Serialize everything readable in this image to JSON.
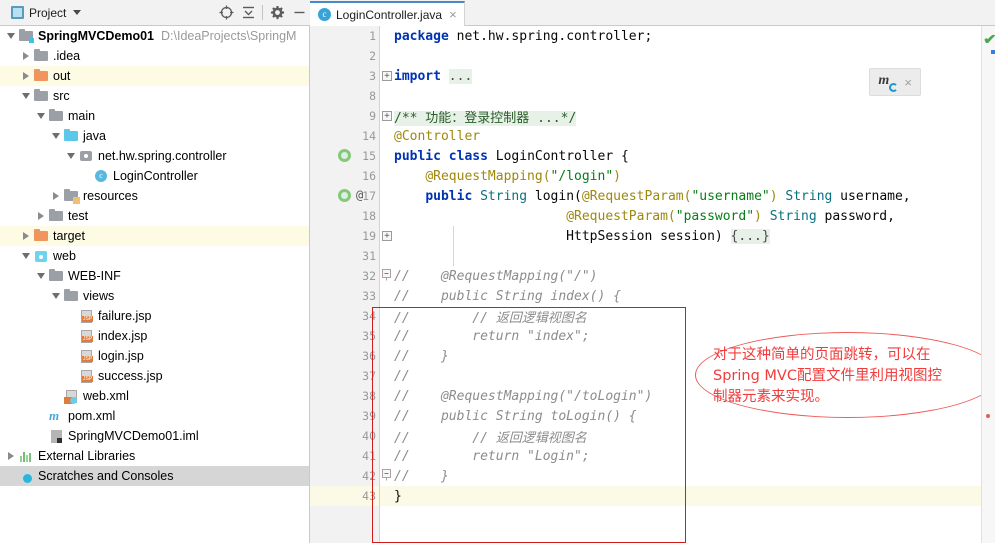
{
  "project_panel": {
    "title": "Project",
    "title_icon": "project-window-icon",
    "toolbar": [
      {
        "name": "locate-icon",
        "glyph": "crosshair"
      },
      {
        "name": "collapse-all-icon",
        "glyph": "collapse"
      },
      {
        "name": "settings-gear-icon",
        "glyph": "gear"
      },
      {
        "name": "hide-panel-icon",
        "glyph": "minus"
      }
    ],
    "tree": [
      {
        "label": "SpringMVCDemo01",
        "path": "D:\\IdeaProjects\\SpringM",
        "indent": 0,
        "twisty": "down",
        "icon": "module-folder-icon",
        "bold": true,
        "highlight": "none"
      },
      {
        "label": ".idea",
        "path": "",
        "indent": 1,
        "twisty": "right",
        "icon": "folder-icon",
        "bold": false,
        "highlight": "none"
      },
      {
        "label": "out",
        "path": "",
        "indent": 1,
        "twisty": "right",
        "icon": "excluded-folder-icon",
        "bold": false,
        "highlight": "yellow"
      },
      {
        "label": "src",
        "path": "",
        "indent": 1,
        "twisty": "down",
        "icon": "folder-icon",
        "bold": false,
        "highlight": "none"
      },
      {
        "label": "main",
        "path": "",
        "indent": 2,
        "twisty": "down",
        "icon": "folder-icon",
        "bold": false,
        "highlight": "none"
      },
      {
        "label": "java",
        "path": "",
        "indent": 3,
        "twisty": "down",
        "icon": "source-root-icon",
        "bold": false,
        "highlight": "none"
      },
      {
        "label": "net.hw.spring.controller",
        "path": "",
        "indent": 4,
        "twisty": "down",
        "icon": "package-icon",
        "bold": false,
        "highlight": "none"
      },
      {
        "label": "LoginController",
        "path": "",
        "indent": 5,
        "twisty": "none",
        "icon": "java-class-icon",
        "bold": false,
        "highlight": "none"
      },
      {
        "label": "resources",
        "path": "",
        "indent": 3,
        "twisty": "right",
        "icon": "resources-root-icon",
        "bold": false,
        "highlight": "none"
      },
      {
        "label": "test",
        "path": "",
        "indent": 2,
        "twisty": "right",
        "icon": "folder-icon",
        "bold": false,
        "highlight": "none"
      },
      {
        "label": "target",
        "path": "",
        "indent": 1,
        "twisty": "right",
        "icon": "excluded-folder-icon",
        "bold": false,
        "highlight": "yellow"
      },
      {
        "label": "web",
        "path": "",
        "indent": 1,
        "twisty": "down",
        "icon": "web-module-icon",
        "bold": false,
        "highlight": "none"
      },
      {
        "label": "WEB-INF",
        "path": "",
        "indent": 2,
        "twisty": "down",
        "icon": "folder-icon",
        "bold": false,
        "highlight": "none"
      },
      {
        "label": "views",
        "path": "",
        "indent": 3,
        "twisty": "down",
        "icon": "folder-icon",
        "bold": false,
        "highlight": "none"
      },
      {
        "label": "failure.jsp",
        "path": "",
        "indent": 4,
        "twisty": "none",
        "icon": "jsp-file-icon",
        "bold": false,
        "highlight": "none"
      },
      {
        "label": "index.jsp",
        "path": "",
        "indent": 4,
        "twisty": "none",
        "icon": "jsp-file-icon",
        "bold": false,
        "highlight": "none"
      },
      {
        "label": "login.jsp",
        "path": "",
        "indent": 4,
        "twisty": "none",
        "icon": "jsp-file-icon",
        "bold": false,
        "highlight": "none"
      },
      {
        "label": "success.jsp",
        "path": "",
        "indent": 4,
        "twisty": "none",
        "icon": "jsp-file-icon",
        "bold": false,
        "highlight": "none"
      },
      {
        "label": "web.xml",
        "path": "",
        "indent": 3,
        "twisty": "none",
        "icon": "xml-file-icon",
        "bold": false,
        "highlight": "none"
      },
      {
        "label": "pom.xml",
        "path": "",
        "indent": 2,
        "twisty": "none",
        "icon": "maven-pom-icon",
        "bold": false,
        "highlight": "none"
      },
      {
        "label": "SpringMVCDemo01.iml",
        "path": "",
        "indent": 2,
        "twisty": "none",
        "icon": "iml-file-icon",
        "bold": false,
        "highlight": "none"
      },
      {
        "label": "External Libraries",
        "path": "",
        "indent": 0,
        "twisty": "right",
        "icon": "external-libraries-icon",
        "bold": false,
        "highlight": "none"
      },
      {
        "label": "Scratches and Consoles",
        "path": "",
        "indent": 0,
        "twisty": "none",
        "icon": "scratches-icon",
        "bold": false,
        "highlight": "gray"
      }
    ]
  },
  "editor": {
    "tab": {
      "label": "LoginController.java",
      "icon_letter": "c",
      "close_glyph": "×"
    },
    "gutter_numbers": [
      "1",
      "2",
      "3",
      "8",
      "9",
      "14",
      "15",
      "16",
      "17",
      "18",
      "19",
      "31",
      "32",
      "33",
      "34",
      "35",
      "36",
      "37",
      "38",
      "39",
      "40",
      "41",
      "42",
      "43"
    ],
    "gutter_marks": {
      "15": "overridden-method-icon",
      "17": "overridden-method-icon"
    },
    "gutter_at_marker": {
      "17": "@"
    },
    "current_line": "43",
    "lines": [
      {
        "n": "1",
        "html": "<span class='kw'>package</span> net.hw.spring.controller;"
      },
      {
        "n": "2",
        "html": ""
      },
      {
        "n": "3",
        "html": "<span class='kw'>import</span> <span class='fld'>...</span>",
        "fold": "plus"
      },
      {
        "n": "8",
        "html": ""
      },
      {
        "n": "9",
        "html": "<span class='docc'>/** 功能：登录控制器 ...*/</span>",
        "fold": "plus"
      },
      {
        "n": "14",
        "html": "<span class='anno'>@Controller</span>"
      },
      {
        "n": "15",
        "html": "<span class='kw'>public</span> <span class='kw'>class</span> LoginController {"
      },
      {
        "n": "16",
        "html": "    <span class='anno'>@RequestMapping(</span><span class='str'>\"/login\"</span><span class='anno'>)</span>"
      },
      {
        "n": "17",
        "html": "    <span class='kw'>public</span> <span class='typ'>String</span> login(<span class='anno'>@RequestParam(</span><span class='str'>\"username\"</span><span class='anno'>)</span> <span class='typ'>String</span> username,"
      },
      {
        "n": "18",
        "html": "                      <span class='anno'>@RequestParam(</span><span class='str'>\"password\"</span><span class='anno'>)</span> <span class='typ'>String</span> password,"
      },
      {
        "n": "19",
        "html": "                      HttpSession session) <span class='fld'>{...}</span>",
        "fold": "plus"
      },
      {
        "n": "31",
        "html": ""
      },
      {
        "n": "32",
        "html": "<span class='cmt'>//    @RequestMapping(\"/\")</span>",
        "fold": "minus"
      },
      {
        "n": "33",
        "html": "<span class='cmt'>//    public String index() {</span>"
      },
      {
        "n": "34",
        "html": "<span class='cmt'>//        // 返回逻辑视图名</span>"
      },
      {
        "n": "35",
        "html": "<span class='cmt'>//        return \"index\";</span>"
      },
      {
        "n": "36",
        "html": "<span class='cmt'>//    }</span>"
      },
      {
        "n": "37",
        "html": "<span class='cmt'>//</span>"
      },
      {
        "n": "38",
        "html": "<span class='cmt'>//    @RequestMapping(\"/toLogin\")</span>"
      },
      {
        "n": "39",
        "html": "<span class='cmt'>//    public String toLogin() {</span>"
      },
      {
        "n": "40",
        "html": "<span class='cmt'>//        // 返回逻辑视图名</span>"
      },
      {
        "n": "41",
        "html": "<span class='cmt'>//        return \"Login\";</span>"
      },
      {
        "n": "42",
        "html": "<span class='cmt'>//    }</span>",
        "fold": "minus"
      },
      {
        "n": "43",
        "html": "}",
        "current": true
      }
    ]
  },
  "annotations": {
    "red_rect_label": "commented-code-highlight",
    "red_note_text": "对于这种简单的页面跳转，可以在\nSpring MVC配置文件里利用视图控\n制器元素来实现。",
    "colors": {
      "rect": "#d21b1b",
      "ellipse": "#ee5a5a",
      "text": "#f23b3b"
    }
  },
  "maven_notification": {
    "icon": "maven-reload-icon",
    "close_glyph": "×"
  },
  "inspection": {
    "status_glyph": "✔",
    "status_color": "#49a84c"
  },
  "colors": {
    "excluded_row": "#fdfbe3",
    "selected_row": "#d6d6d6",
    "tab_active_top": "#4a88c7",
    "keyword": "#0033b3",
    "annotation": "#9e880d",
    "string": "#067d17",
    "comment": "#8c8c8c",
    "folded": "#e7f1e7"
  }
}
